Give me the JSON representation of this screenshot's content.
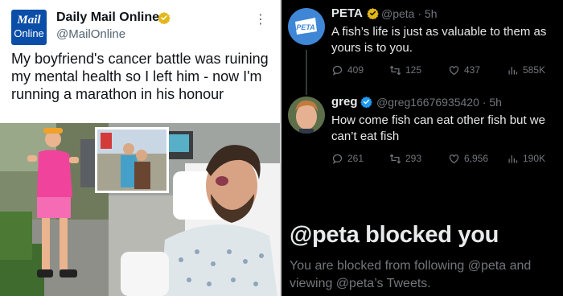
{
  "left_tweet": {
    "logo_line1": "Mail",
    "logo_line2": "Online",
    "name": "Daily Mail Online",
    "handle": "@MailOnline",
    "more": "⋮",
    "text": "My boyfriend's cancer battle was ruining my mental health so I left him - now I'm running a marathon in his honour",
    "brand_color": "#0a4ea8",
    "verified_color": "#e2b719"
  },
  "tweets": [
    {
      "name": "PETA",
      "handle": "@peta · 5h",
      "avatar_text": "PETA",
      "text": "A fish’s life is just as valuable to them as yours is to you.",
      "replies": "409",
      "retweets": "125",
      "likes": "437",
      "views": "585K",
      "verified_color": "#e2b719"
    },
    {
      "name": "greg",
      "handle": "@greg16676935420 · 5h",
      "text": "How come fish can eat other fish but we can’t eat fish",
      "replies": "261",
      "retweets": "293",
      "likes": "6,956",
      "views": "190K",
      "verified_color": "#1d9bf0"
    }
  ],
  "blocked": {
    "title": "@peta blocked you",
    "subtitle": "You are blocked from following @peta and viewing @peta’s Tweets."
  },
  "icons": [
    "reply-icon",
    "retweet-icon",
    "like-icon",
    "views-icon",
    "verified-badge-icon",
    "more-icon"
  ],
  "colors": {
    "dark_bg": "#000000",
    "muted": "#71767b",
    "text_light": "#e7e9ea"
  }
}
